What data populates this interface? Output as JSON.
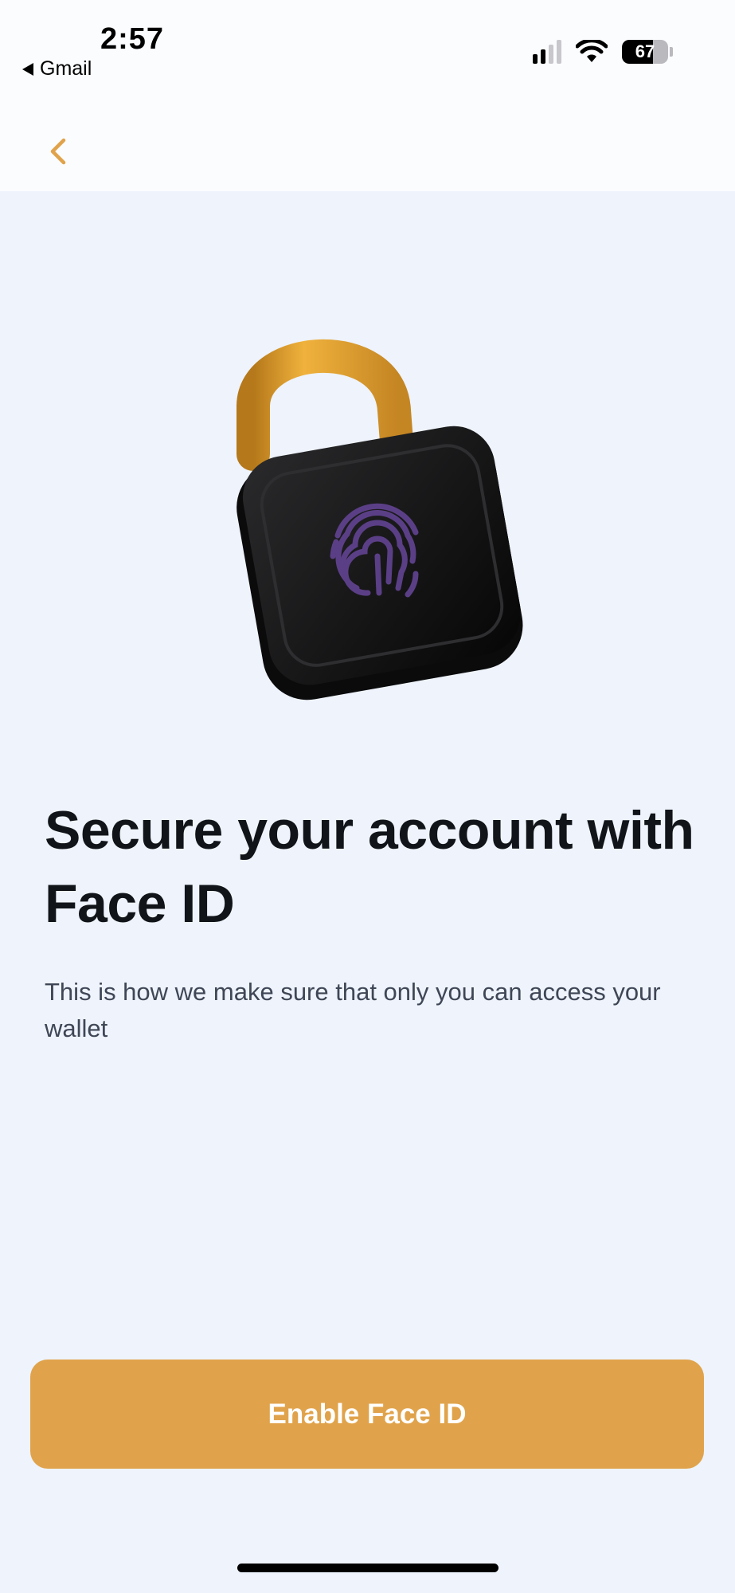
{
  "status_bar": {
    "time": "2:57",
    "back_app": "Gmail",
    "battery_percent": 67,
    "battery_label": "67",
    "signal_bars_active": 2,
    "signal_bars_total": 4
  },
  "header": {
    "back_icon": "chevron-left-icon"
  },
  "illustration": {
    "icon": "padlock-fingerprint-icon"
  },
  "content": {
    "title": "Secure your account with Face ID",
    "subtitle": "This is how we make sure that only you can access your wallet"
  },
  "cta": {
    "label": "Enable Face ID"
  },
  "colors": {
    "accent": "#e0a34b",
    "background": "#eef3fc",
    "title": "#111418",
    "subtitle": "#3f4655",
    "fingerprint": "#5b3f86"
  }
}
